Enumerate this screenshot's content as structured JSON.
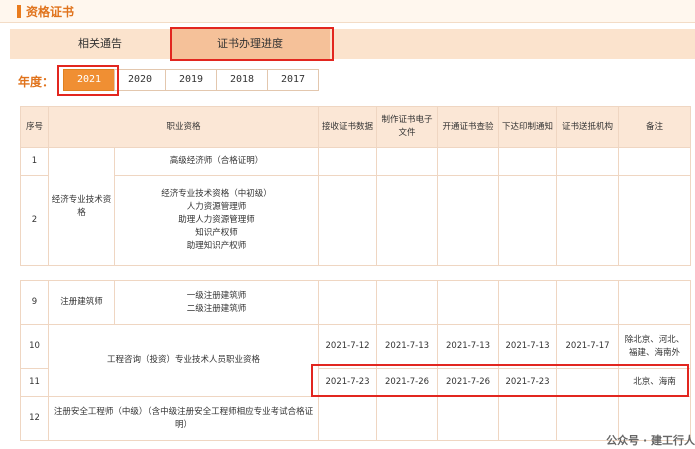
{
  "section": {
    "title": "资格证书"
  },
  "tabs": [
    {
      "label": "相关通告"
    },
    {
      "label": "证书办理进度"
    }
  ],
  "year_label": "年度：",
  "years": [
    "2021",
    "2020",
    "2019",
    "2018",
    "2017"
  ],
  "table": {
    "headers": [
      "序号",
      "职业资格",
      "接收证书数据",
      "制作证书电子文件",
      "开通证书查验",
      "下达印制通知",
      "证书送抵机构",
      "备注"
    ],
    "rows": {
      "r1": {
        "no": "1",
        "sub": "高级经济师（合格证明）"
      },
      "r2": {
        "no": "2",
        "main": "经济专业技术资格",
        "sub": [
          "经济专业技术资格（中初级）",
          "人力资源管理师",
          "助理人力资源管理师",
          "知识产权师",
          "助理知识产权师"
        ]
      },
      "r9": {
        "no": "9",
        "main": "注册建筑师",
        "sub": [
          "一级注册建筑师",
          "二级注册建筑师"
        ]
      },
      "r10": {
        "no": "10",
        "main": "工程咨询（投资）专业技术人员职业资格",
        "c1": "2021-7-12",
        "c2": "2021-7-13",
        "c3": "2021-7-13",
        "c4": "2021-7-13",
        "c5": "2021-7-17",
        "note": "除北京、河北、福建、海南外"
      },
      "r11": {
        "no": "11",
        "c1": "2021-7-23",
        "c2": "2021-7-26",
        "c3": "2021-7-26",
        "c4": "2021-7-23",
        "c5": "",
        "note": "北京、海南"
      },
      "r12": {
        "no": "12",
        "main": "注册安全工程师（中级）（含中级注册安全工程师相应专业考试合格证明）"
      }
    }
  },
  "watermark": "公众号 · 建工行人"
}
